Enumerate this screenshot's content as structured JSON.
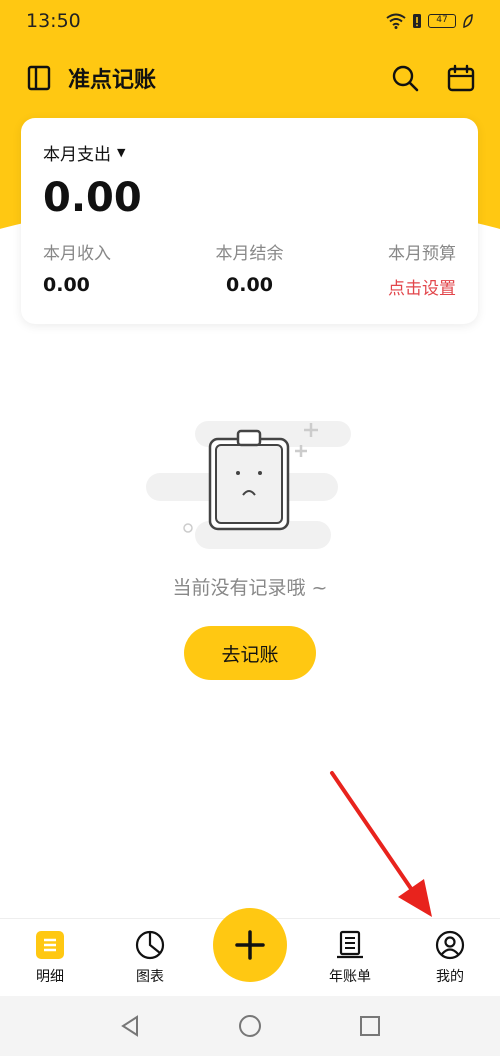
{
  "status_bar": {
    "time": "13:50",
    "battery": "47"
  },
  "header": {
    "title": "准点记账"
  },
  "summary": {
    "expense_label": "本月支出",
    "expense_value": "0.00",
    "income_label": "本月收入",
    "income_value": "0.00",
    "balance_label": "本月结余",
    "balance_value": "0.00",
    "budget_label": "本月预算",
    "budget_link": "点击设置"
  },
  "empty": {
    "message": "当前没有记录哦 ~",
    "button": "去记账"
  },
  "tabs": [
    {
      "label": "明细",
      "icon": "list-icon"
    },
    {
      "label": "图表",
      "icon": "pie-chart-icon"
    },
    {
      "label": "",
      "icon": "plus-icon"
    },
    {
      "label": "年账单",
      "icon": "receipt-icon"
    },
    {
      "label": "我的",
      "icon": "user-icon"
    }
  ],
  "colors": {
    "accent": "#FFC812",
    "link": "#E2464B",
    "muted": "#888888"
  }
}
